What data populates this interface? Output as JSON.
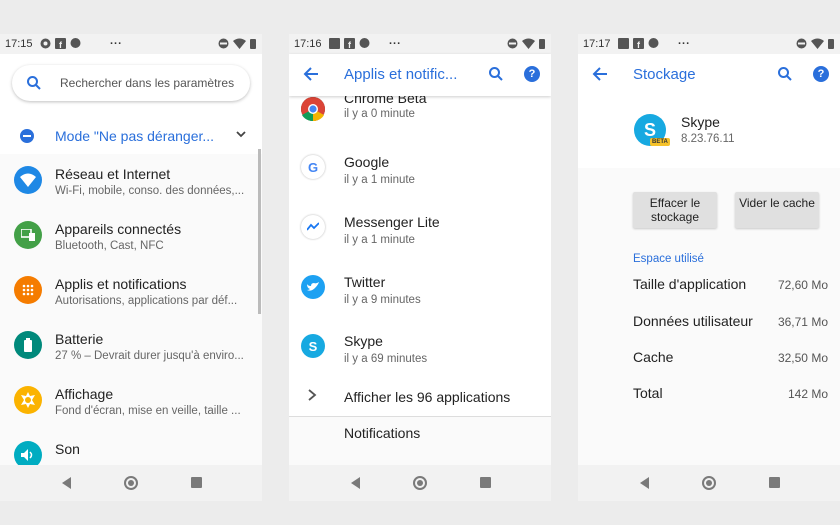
{
  "colors": {
    "accent": "#2a6fdb",
    "background": "#ececec"
  },
  "phone1": {
    "status_time": "17:15",
    "search_placeholder": "Rechercher dans les paramètres",
    "dnd_label": "Mode \"Ne pas déranger...",
    "settings": [
      {
        "title": "Réseau et Internet",
        "subtitle": "Wi-Fi, mobile, conso. des données,...",
        "icon": "wifi-icon",
        "color": "#1e88e5"
      },
      {
        "title": "Appareils connectés",
        "subtitle": "Bluetooth, Cast, NFC",
        "icon": "devices-icon",
        "color": "#43a047"
      },
      {
        "title": "Applis et notifications",
        "subtitle": "Autorisations, applications par déf...",
        "icon": "apps-icon",
        "color": "#f57c00"
      },
      {
        "title": "Batterie",
        "subtitle": "27 % – Devrait durer jusqu'à enviro...",
        "icon": "battery-icon",
        "color": "#00897b"
      },
      {
        "title": "Affichage",
        "subtitle": "Fond d'écran, mise en veille, taille ...",
        "icon": "brightness-icon",
        "color": "#fbb300"
      },
      {
        "title": "Son",
        "subtitle": "",
        "icon": "volume-icon",
        "color": "#00acc1"
      }
    ]
  },
  "phone2": {
    "status_time": "17:16",
    "title": "Applis et notific...",
    "apps": [
      {
        "name": "Chrome Beta",
        "time": "il y a 0 minute",
        "icon": "chrome-beta-icon"
      },
      {
        "name": "Google",
        "time": "il y a 1 minute",
        "icon": "google-icon"
      },
      {
        "name": "Messenger Lite",
        "time": "il y a 1 minute",
        "icon": "messenger-lite-icon"
      },
      {
        "name": "Twitter",
        "time": "il y a 9 minutes",
        "icon": "twitter-icon"
      },
      {
        "name": "Skype",
        "time": "il y a 69 minutes",
        "icon": "skype-icon"
      }
    ],
    "show_all": "Afficher les 96 applications",
    "notifications": "Notifications"
  },
  "phone3": {
    "status_time": "17:17",
    "title": "Stockage",
    "app_name": "Skype",
    "app_version": "8.23.76.11",
    "beta_badge": "BETA",
    "btn_clear": "Effacer le stockage",
    "btn_cache": "Vider le cache",
    "section": "Espace utilisé",
    "rows": [
      {
        "label": "Taille d'application",
        "value": "72,60 Mo"
      },
      {
        "label": "Données utilisateur",
        "value": "36,71 Mo"
      },
      {
        "label": "Cache",
        "value": "32,50 Mo"
      },
      {
        "label": "Total",
        "value": "142 Mo"
      }
    ]
  }
}
